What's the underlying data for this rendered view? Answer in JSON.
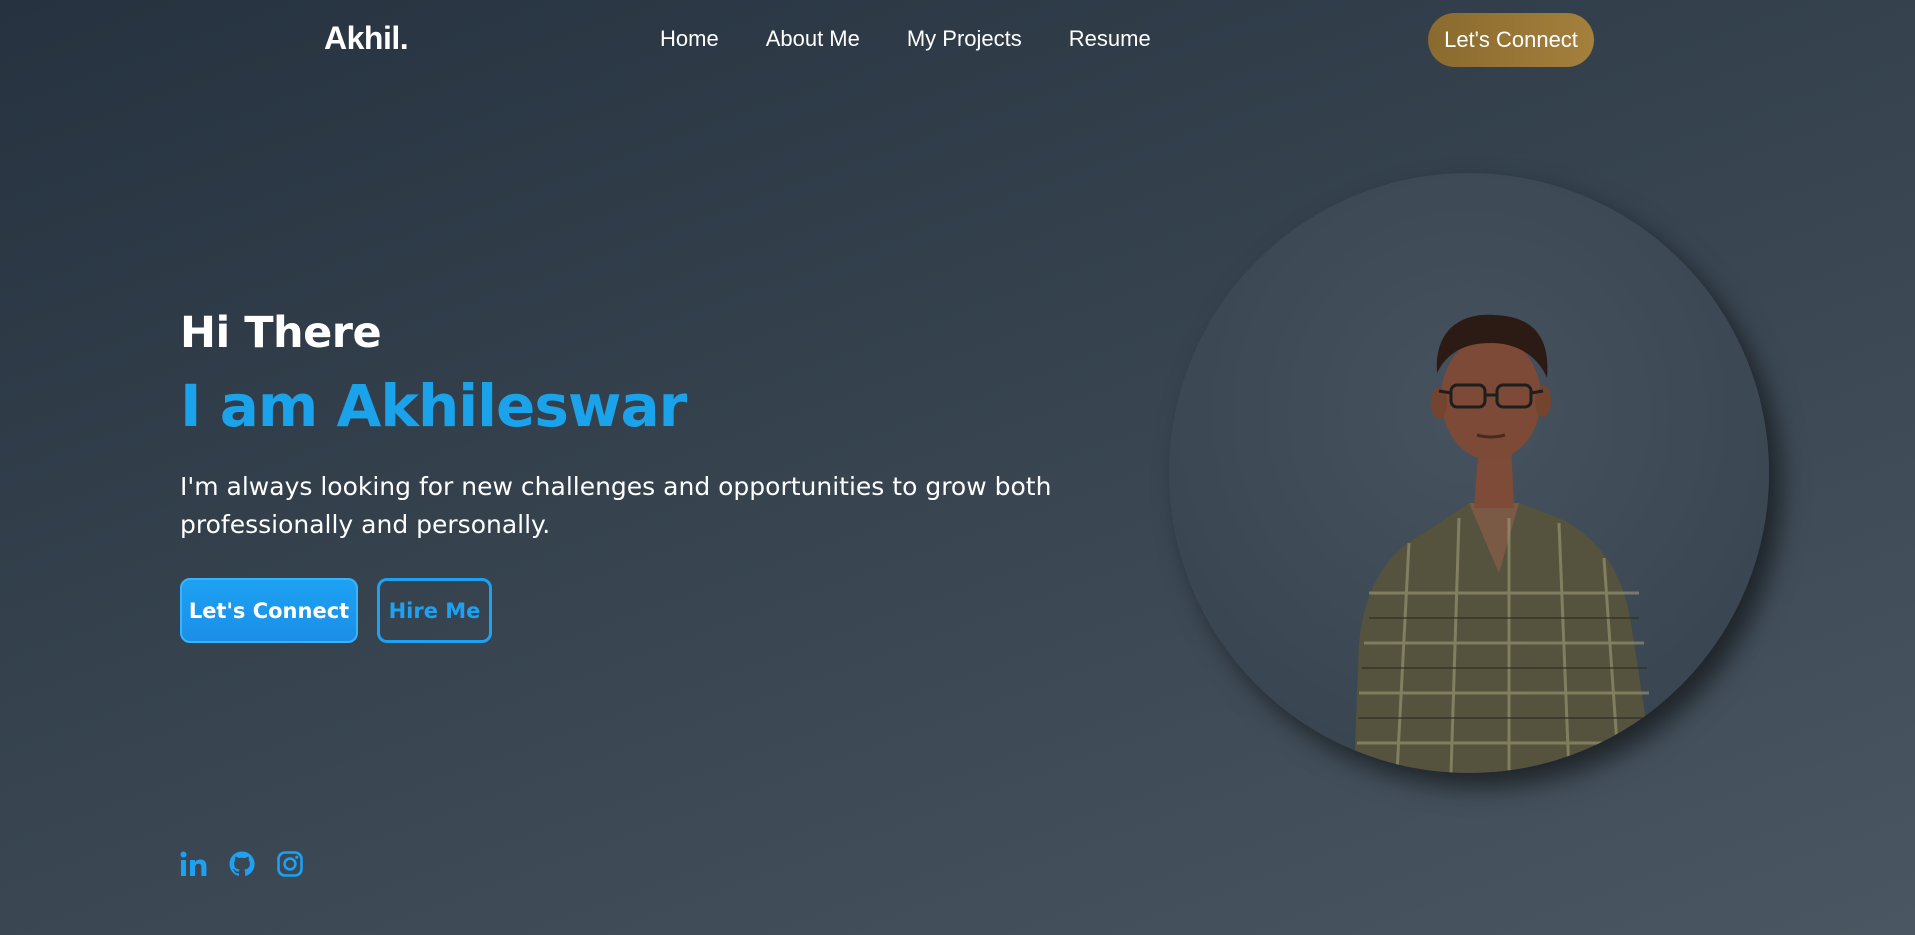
{
  "brand": {
    "logo": "Akhil."
  },
  "nav": {
    "links": [
      "Home",
      "About Me",
      "My Projects",
      "Resume"
    ],
    "cta": "Let's Connect"
  },
  "hero": {
    "greeting": "Hi There",
    "name": "I am Akhileswar",
    "tagline": "I'm always looking for new challenges and opportunities to grow both professionally and personally.",
    "primary_button": "Let's Connect",
    "secondary_button": "Hire Me"
  },
  "socials": [
    "linkedin-icon",
    "github-icon",
    "instagram-icon"
  ],
  "colors": {
    "accent": "#1da1f2",
    "cta_gold": "#9a7838",
    "background_start": "#26323f",
    "background_end": "#4a5661"
  }
}
